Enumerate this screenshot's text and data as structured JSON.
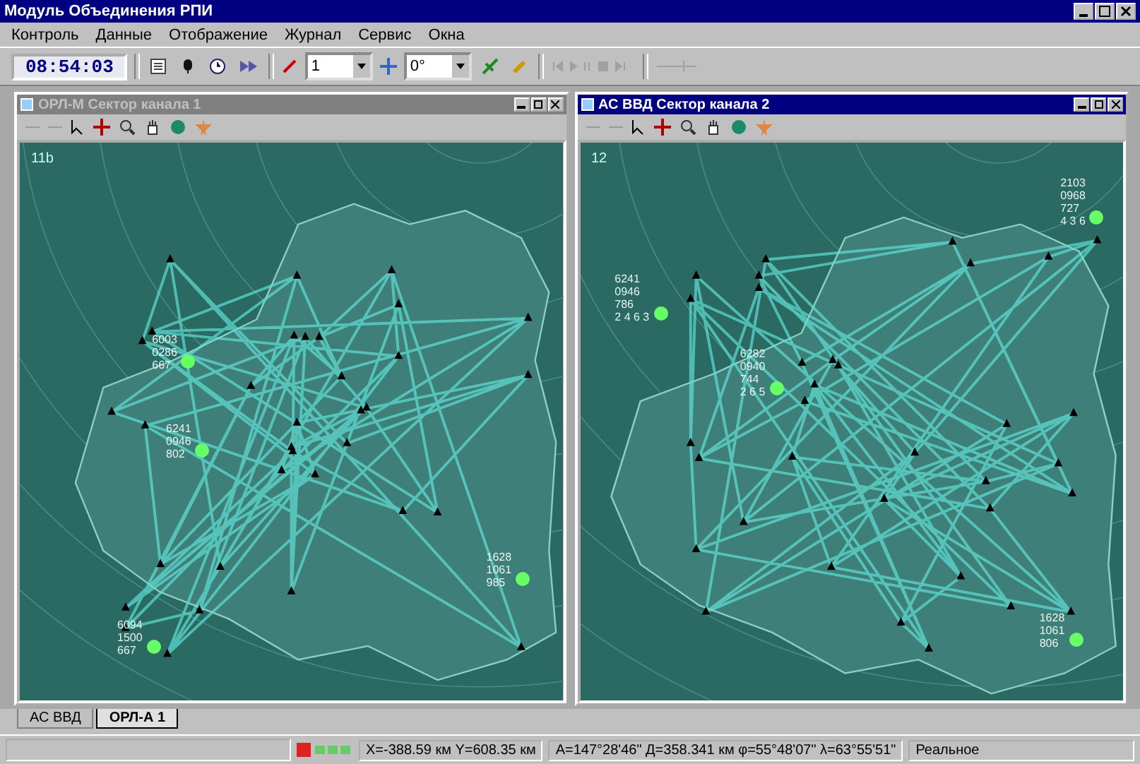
{
  "window": {
    "title": "Модуль Объединения РПИ"
  },
  "menu": [
    "Контроль",
    "Данные",
    "Отображение",
    "Журнал",
    "Сервис",
    "Окна"
  ],
  "toolbar": {
    "clock": "08:54:03",
    "range_select": {
      "value": "1"
    },
    "angle_select": {
      "value": "0°"
    }
  },
  "child_windows": [
    {
      "title": "ОРЛ-М Сектор канала 1",
      "active": false,
      "sector_label": "11b",
      "tracks": [
        {
          "lines": [
            "6003",
            "0286",
            "667"
          ]
        },
        {
          "lines": [
            "6241",
            "0946",
            "802"
          ]
        },
        {
          "lines": [
            "1628",
            "1061",
            "985"
          ]
        },
        {
          "lines": [
            "6094",
            "1500",
            "667"
          ]
        }
      ]
    },
    {
      "title": "АС ВВД Сектор канала 2",
      "active": true,
      "sector_label": "12",
      "tracks": [
        {
          "lines": [
            "2103",
            "0968",
            "727",
            "4 3 6"
          ]
        },
        {
          "lines": [
            "6241",
            "0946",
            "786",
            "2 4 6 3"
          ]
        },
        {
          "lines": [
            "6282",
            "0940",
            "744",
            "2 6 5"
          ]
        },
        {
          "lines": [
            "1628",
            "1061",
            "806"
          ]
        }
      ]
    }
  ],
  "window_tabs": [
    {
      "label": "АС ВВД",
      "selected": false
    },
    {
      "label": "ОРЛ-А 1",
      "selected": true
    }
  ],
  "status_bar": {
    "coordinates": "X=-388.59 км  Y=608.35 км",
    "position": "A=147°28'46\" Д=358.341 км φ=55°48'07\" λ=63°55'51\"",
    "mode": "Реальное"
  }
}
